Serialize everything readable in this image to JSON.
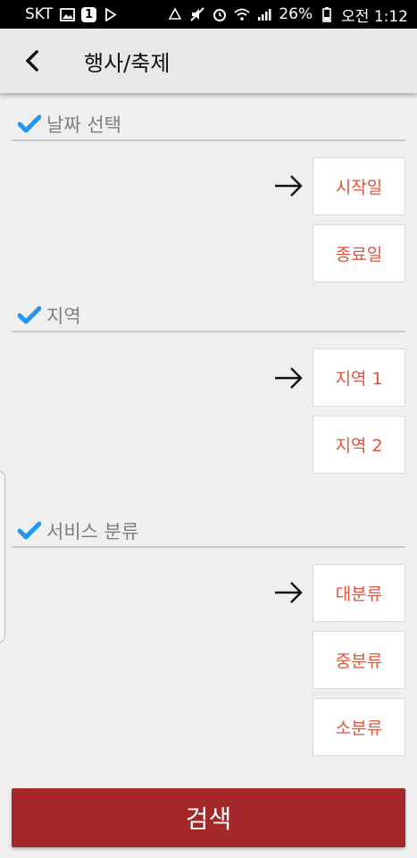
{
  "status_bar": {
    "carrier": "SKT",
    "notification_count": "1",
    "battery_percent": "26%",
    "time": "오전 1:12",
    "icons": [
      "image-icon",
      "play-icon",
      "recycle-icon",
      "mute-icon",
      "alarm-icon",
      "wifi-icon",
      "signal-icon",
      "battery-icon"
    ]
  },
  "app_bar": {
    "title": "행사/축제",
    "back_icon": "chevron-left-icon"
  },
  "sections": {
    "date": {
      "label": "날짜 선택",
      "start_label": "시작일",
      "end_label": "종료일"
    },
    "region": {
      "label": "지역",
      "region1_label": "지역 1",
      "region2_label": "지역 2"
    },
    "service": {
      "label": "서비스 분류",
      "major_label": "대분류",
      "middle_label": "중분류",
      "minor_label": "소분류"
    }
  },
  "search_button": {
    "label": "검색"
  },
  "colors": {
    "accent_red": "#a4282a",
    "option_text": "#e2533b",
    "check_blue": "#2196f3",
    "section_text": "#7f7f7f"
  }
}
